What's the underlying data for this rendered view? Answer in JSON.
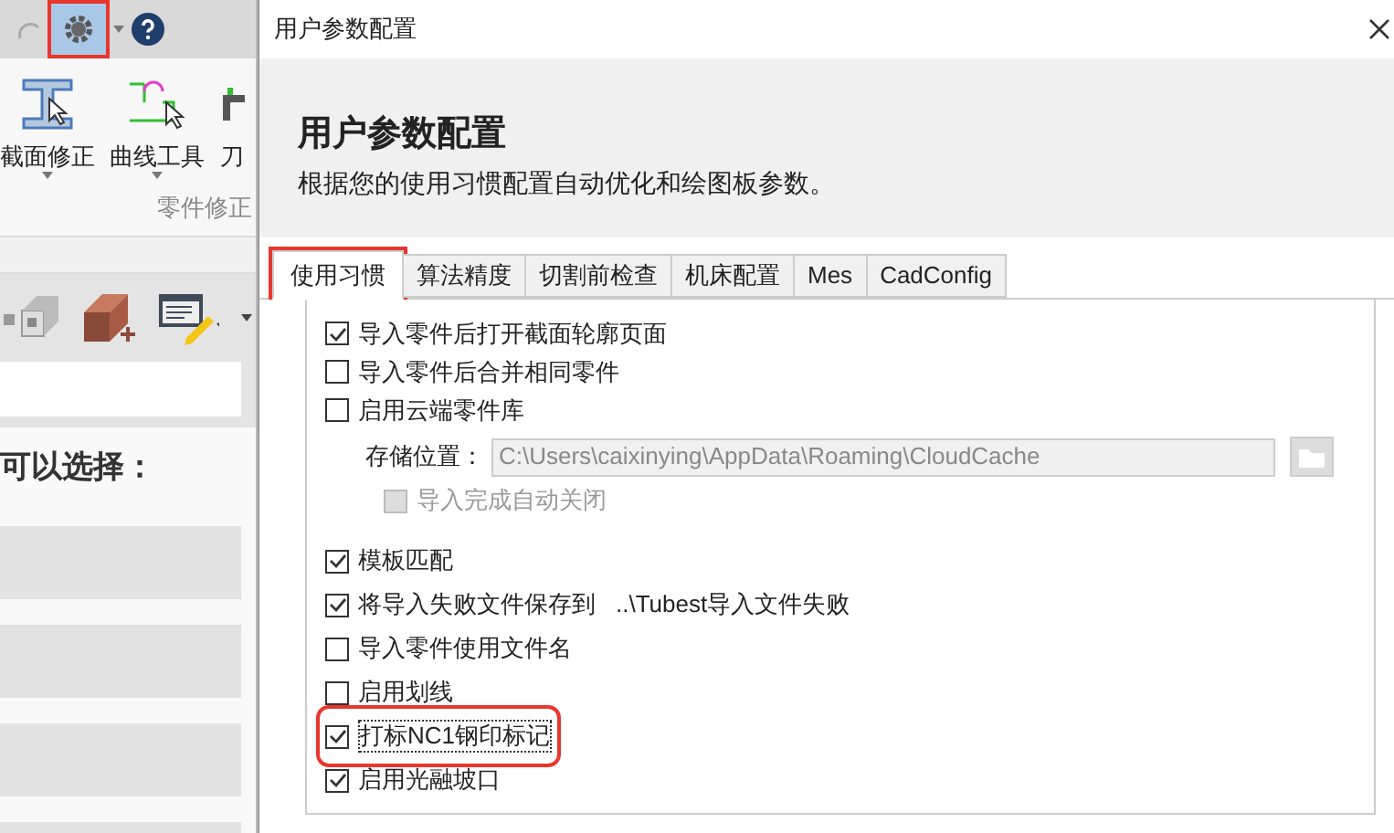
{
  "app": {
    "toolbar": {
      "gear_highlighted": true
    },
    "ribbon": {
      "tools": [
        {
          "kind": "section",
          "label": "截面修正"
        },
        {
          "kind": "curve",
          "label": "曲线工具"
        },
        {
          "kind": "path",
          "label": "刀"
        }
      ],
      "group_label": "零件修正"
    },
    "prompt": "可以选择："
  },
  "dialog": {
    "window_title": "用户参数配置",
    "heading": "用户参数配置",
    "subtitle": "根据您的使用习惯配置自动优化和绘图板参数。",
    "tabs": [
      {
        "label": "使用习惯",
        "selected": true,
        "highlighted": true
      },
      {
        "label": "算法精度",
        "selected": false,
        "highlighted": false
      },
      {
        "label": "切割前检查",
        "selected": false,
        "highlighted": false
      },
      {
        "label": "机床配置",
        "selected": false,
        "highlighted": false
      },
      {
        "label": "Mes",
        "selected": false,
        "highlighted": false
      },
      {
        "label": "CadConfig",
        "selected": false,
        "highlighted": false
      }
    ],
    "options": [
      {
        "kind": "checkbox",
        "label": "导入零件后打开截面轮廓页面",
        "checked": true,
        "highlighted": false
      },
      {
        "kind": "checkbox",
        "label": "导入零件后合并相同零件",
        "checked": false,
        "highlighted": false
      },
      {
        "kind": "checkbox",
        "label": "启用云端零件库",
        "checked": false,
        "highlighted": false
      },
      {
        "kind": "path",
        "label": "存储位置：",
        "value": "C:\\Users\\caixinying\\AppData\\Roaming\\CloudCache"
      },
      {
        "kind": "subcheckbox",
        "label": "导入完成自动关闭",
        "checked": false
      },
      {
        "kind": "checkbox",
        "label": "模板匹配",
        "checked": true,
        "highlighted": false
      },
      {
        "kind": "checkbox",
        "label": "将导入失败文件保存到",
        "detail": "..\\Tubest导入文件失败",
        "checked": true,
        "highlighted": false
      },
      {
        "kind": "checkbox",
        "label": "导入零件使用文件名",
        "checked": false,
        "highlighted": false
      },
      {
        "kind": "checkbox",
        "label": "启用划线",
        "checked": false,
        "highlighted": false
      },
      {
        "kind": "checkbox",
        "label": "打标NC1钢印标记",
        "checked": true,
        "highlighted": true
      },
      {
        "kind": "checkbox",
        "label": "启用光融坡口",
        "checked": true,
        "highlighted": false
      }
    ]
  }
}
